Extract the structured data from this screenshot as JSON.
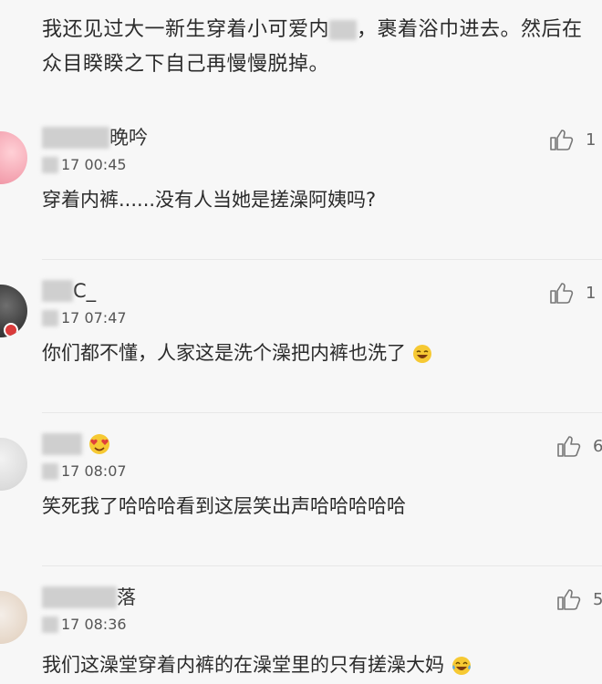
{
  "post": {
    "line1_a": "我还见过大一新生穿着小可爱内",
    "line1_b": "，裹着浴巾进去。然后在",
    "line2": "众目睽睽之下自己再慢慢脱掉。"
  },
  "comments": [
    {
      "username_visible": "晚吟",
      "time": "17 00:45",
      "text": "穿着内裤......没有人当她是搓澡阿姨吗?",
      "likes": "1"
    },
    {
      "username_visible": "C_",
      "time": "17 07:47",
      "text": "你们都不懂，人家这是洗个澡把内裤也洗了",
      "likes": "1"
    },
    {
      "username_visible": "",
      "time": "17 08:07",
      "text": "笑死我了哈哈哈看到这层笑出声哈哈哈哈哈",
      "likes": "6"
    },
    {
      "username_visible": "落",
      "time": "17 08:36",
      "text": "我们这澡堂穿着内裤的在澡堂里的只有搓澡大妈",
      "likes": "5"
    }
  ],
  "icons": {
    "like": "thumbs-up-icon",
    "laugh_emoji": "laughing-emoji-icon",
    "heart_eyes_emoji": "heart-eyes-emoji-icon",
    "tears_emoji": "tears-of-joy-emoji-icon"
  },
  "colors": {
    "background": "#f7f7f7",
    "text": "#2b2b2b",
    "meta": "#555555",
    "icon": "#777777"
  }
}
